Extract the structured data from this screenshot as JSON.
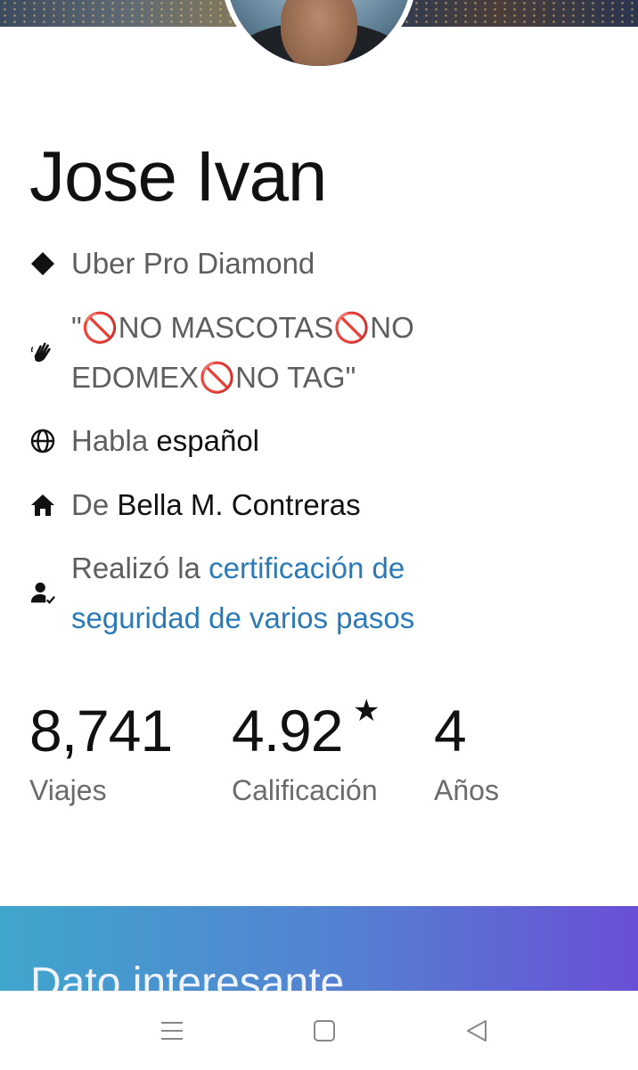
{
  "profile": {
    "name": "Jose Ivan",
    "tier": "Uber Pro Diamond",
    "note_line1": "\"🚫NO MASCOTAS🚫NO",
    "note_line2": "EDOMEX🚫NO TAG\"",
    "language_prefix": "Habla",
    "language": "español",
    "from_prefix": "De",
    "from": "Bella M. Contreras",
    "cert_prefix": "Realizó la",
    "cert_link_1": "certificación de",
    "cert_link_2": "seguridad de varios pasos"
  },
  "stats": [
    {
      "value": "8,741",
      "label": "Viajes"
    },
    {
      "value": "4.92",
      "label": "Calificación"
    },
    {
      "value": "4",
      "label": "Años"
    }
  ],
  "rating_star": "★",
  "promo": {
    "title": "Dato interesante"
  },
  "icons": {
    "tier": "diamond-icon",
    "note": "wave-hand-icon",
    "language": "globe-icon",
    "home": "home-icon",
    "verified": "verified-user-icon",
    "nav_menu": "menu-icon",
    "nav_home": "square-icon",
    "nav_back": "back-triangle-icon"
  },
  "colors": {
    "link": "#2a7ab8",
    "promo_start": "#3fa6cc",
    "promo_end": "#6a4fd6"
  }
}
